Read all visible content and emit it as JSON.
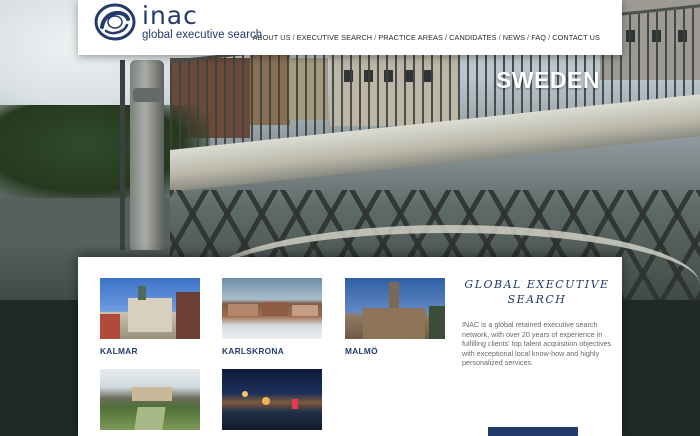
{
  "brand": {
    "name": "inac",
    "tagline": "global executive search",
    "color": "#243c6c"
  },
  "nav": {
    "items": [
      "ABOUT US",
      "EXECUTIVE SEARCH",
      "PRACTICE AREAS",
      "CANDIDATES",
      "NEWS",
      "FAQ",
      "CONTACT US"
    ],
    "separator": "/"
  },
  "hero": {
    "country": "SWEDEN"
  },
  "cities": [
    {
      "name": "KALMAR"
    },
    {
      "name": "KARLSKRONA"
    },
    {
      "name": "MALMÖ"
    },
    {
      "name": ""
    },
    {
      "name": ""
    }
  ],
  "about": {
    "heading_line1": "GLOBAL EXECUTIVE",
    "heading_line2": "SEARCH",
    "body": "INAC is a global retained executive search network, with over 20 years of experience in fulfilling clients' top talent acquisition objectives with exceptional local know-how and highly personalized services."
  },
  "icons": {
    "logo": "inac-swirl-logo-icon"
  }
}
